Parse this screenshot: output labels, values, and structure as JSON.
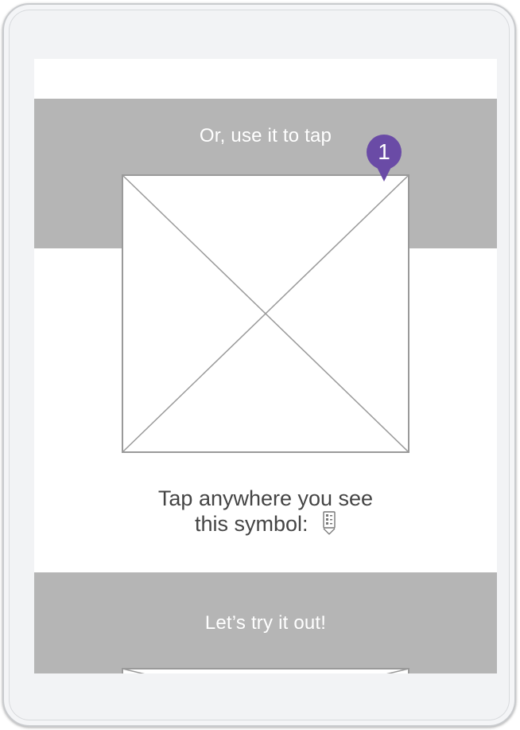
{
  "screen": {
    "top_band": {
      "text": "Or, use it to tap"
    },
    "instruction": {
      "line1": "Tap anywhere you see",
      "line2": "this symbol:"
    },
    "bottom_band": {
      "text": "Let’s try it out!"
    }
  },
  "annotation": {
    "number": "1",
    "color": "#6a4ba6"
  },
  "colors": {
    "band": "#b5b5b5",
    "placeholder_stroke": "#9a9a9a",
    "device_bezel": "#f2f3f5"
  },
  "icons": {
    "symbol": "tap-target-symbol-icon",
    "placeholder": "image-placeholder-icon"
  }
}
